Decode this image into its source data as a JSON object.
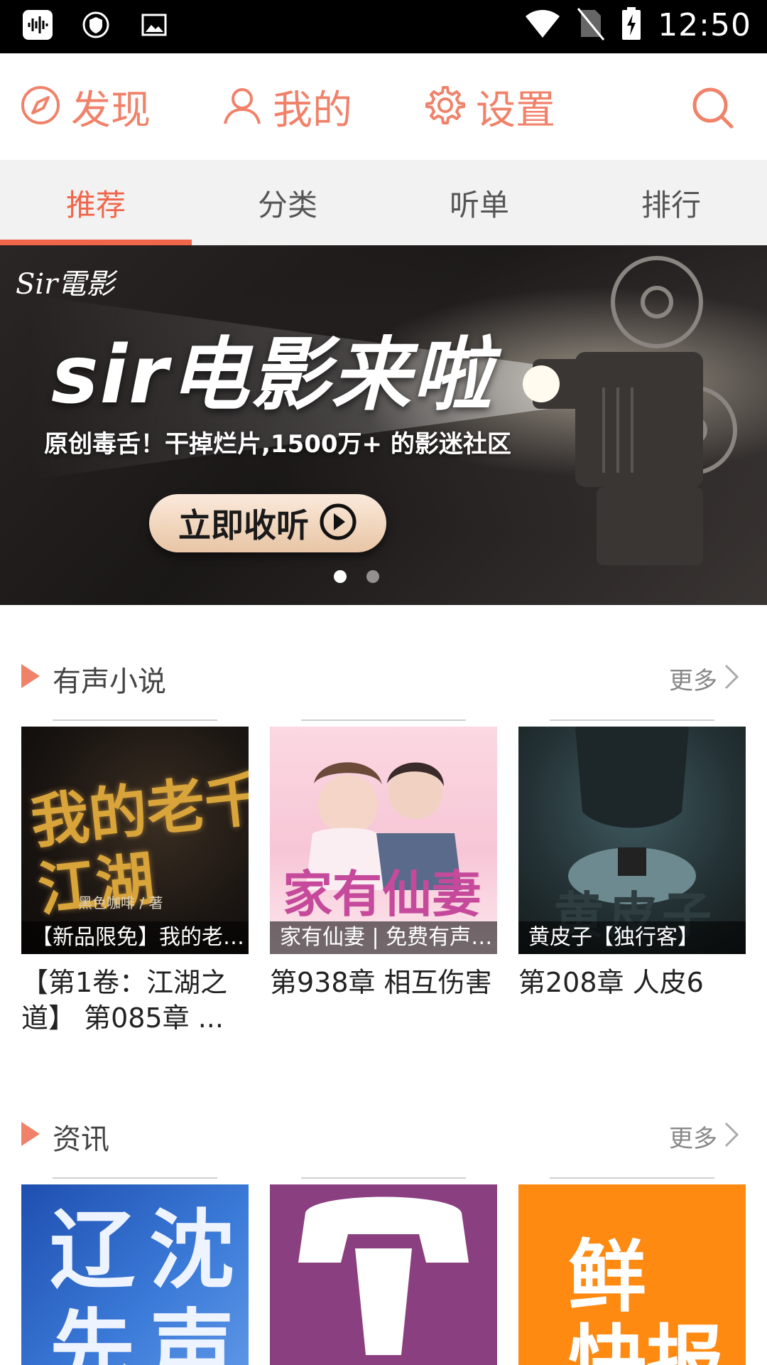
{
  "status_bar": {
    "time": "12:50",
    "icons": [
      "audio-wave-icon",
      "vpn-shield-icon",
      "image-icon",
      "wifi-icon",
      "no-sim-icon",
      "battery-charging-icon"
    ]
  },
  "top_nav": {
    "items": [
      {
        "label": "发现",
        "icon": "compass-icon"
      },
      {
        "label": "我的",
        "icon": "user-icon"
      },
      {
        "label": "设置",
        "icon": "gear-icon"
      }
    ],
    "search_icon": "search-icon",
    "accent_color": "#f0826a"
  },
  "tabs": {
    "items": [
      "推荐",
      "分类",
      "听单",
      "排行"
    ],
    "active_index": 0,
    "active_color": "#f0664a"
  },
  "banner": {
    "logo": "Sir電影",
    "title": "sir电影来啦",
    "subtitle": "原创毒舌！干掉烂片,1500万+ 的影迷社区",
    "cta_label": "立即收听",
    "page_count": 2,
    "active_page": 0
  },
  "sections": [
    {
      "title": "有声小说",
      "more_label": "更多",
      "items": [
        {
          "caption": "【新品限免】我的老千江湖",
          "description": "【第1卷：江湖之道】 第085章 ...",
          "cover_text": "我的老千\n江湖",
          "cover_small": "黑色咖啡 / 著"
        },
        {
          "caption": "家有仙妻 | 免费有声小说",
          "description": "第938章 相互伤害",
          "cover_text": "家有仙妻"
        },
        {
          "caption": "黄皮子【独行客】",
          "description": "第208章 人皮6",
          "cover_text": "黄皮子"
        }
      ]
    },
    {
      "title": "资讯",
      "more_label": "更多",
      "items": [
        {
          "cover_text": "辽沈\n先声"
        },
        {
          "cover_text": ""
        },
        {
          "cover_text": "鲜\n快报"
        }
      ]
    }
  ]
}
